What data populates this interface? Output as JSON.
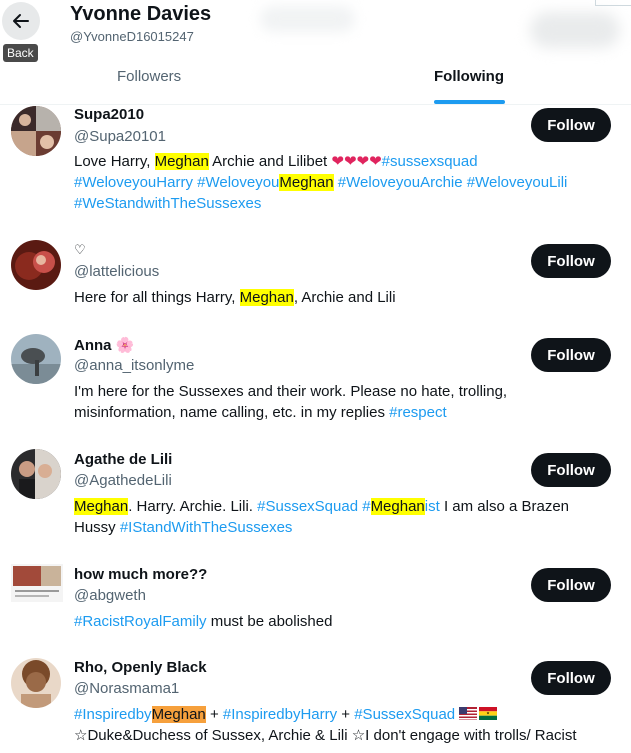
{
  "profile": {
    "name": "Yvonne Davies",
    "handle": "@YvonneD16015247",
    "back_tooltip": "Back"
  },
  "tabs": [
    {
      "label": "Followers"
    },
    {
      "label": "Following",
      "active": true
    }
  ],
  "follow_label": "Follow",
  "users": [
    {
      "name": "Supa2010",
      "handle": "@Supa20101",
      "bio": {
        "t1": "Love Harry, ",
        "hl1": "Meghan",
        "t2": " Archie and Lilibet ",
        "hearts": "❤❤❤❤",
        "tag1": "#sussexsquad",
        "tag2": "#WeloveyouHarry",
        "tag3a": "#Weloveyou",
        "tag3hl": "Meghan",
        "tag4": "#WeloveyouArchie",
        "tag5": "#WeloveyouLili",
        "tag6": "#WeStandwithTheSussexes"
      }
    },
    {
      "name": "♡",
      "handle": "@lattelicious",
      "bio": {
        "t1": "Here for all things Harry, ",
        "hl1": "Meghan",
        "t2": ", Archie and Lili"
      }
    },
    {
      "name": "Anna",
      "name_emoji": "🌸",
      "handle": "@anna_itsonlyme",
      "bio": {
        "t1": "I'm here for the Sussexes and their work. Please no hate, trolling, misinformation, name calling, etc. in my replies ",
        "tag1": "#respect"
      }
    },
    {
      "name": "Agathe de Lili",
      "handle": "@AgathedeLili",
      "bio": {
        "hl1": "Meghan",
        "t1": ". Harry. Archie. Lili. ",
        "tag1": "#SussexSquad",
        "tag2a": "#",
        "tag2hl": "Meghan",
        "tag2b": "ist",
        "t2": " I am also a Brazen Hussy ",
        "tag3": "#IStandWithTheSussexes"
      }
    },
    {
      "name": "how much more??",
      "handle": "@abgweth",
      "bio": {
        "tag1": "#RacistRoyalFamily",
        "t1": " must be abolished"
      }
    },
    {
      "name": "Rho, Openly Black",
      "handle": "@Norasmama1",
      "bio": {
        "tag1a": "#Inspiredby",
        "tag1hl": "Meghan",
        "t1": " + ",
        "tag2": "#InspiredbyHarry",
        "t2": " + ",
        "tag3": "#SussexSquad",
        "line2": "☆Duke&Duchess of Sussex, Archie & Lili ☆I don't engage with trolls/ Racist"
      }
    }
  ]
}
